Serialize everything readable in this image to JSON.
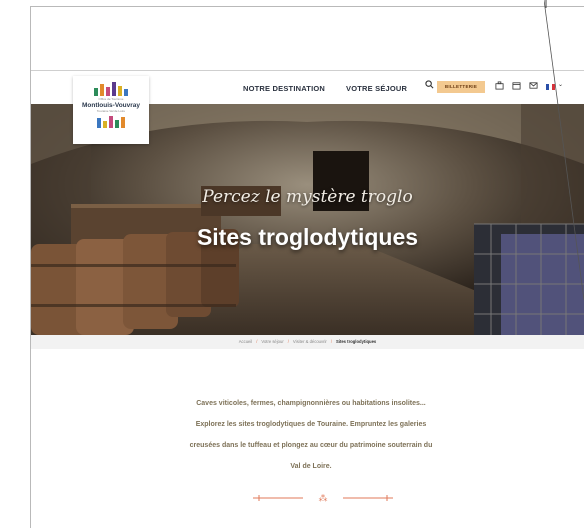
{
  "header": {
    "nav": [
      "NOTRE DESTINATION",
      "VOTRE SÉJOUR"
    ],
    "ticket_label": "BILLETTERIE",
    "icons": [
      "search-icon",
      "pro-icon",
      "calendar-icon",
      "mail-icon",
      "flag-fr-icon"
    ]
  },
  "logo": {
    "tag_top": "Office de Tourisme",
    "name": "Montlouis-Vouvray",
    "tag_bot": "Touraine Val de Loire"
  },
  "hero": {
    "script": "Percez le mystère troglo",
    "title": "Sites troglodytiques"
  },
  "breadcrumb": [
    "Accueil",
    "Votre séjour",
    "Visiter & découvrir",
    "Sites troglodytiques"
  ],
  "intro": {
    "line1": "Caves viticoles, fermes, champignonnières ou habitations insolites...",
    "line2": "Explorez les sites troglodytiques de Touraine. Empruntez les galeries",
    "line3": "creusées dans le tuffeau et plongez au cœur du patrimoine souterrain du",
    "line4": "Val de Loire."
  },
  "colors": {
    "accent": "#e07a5a",
    "ticket_bg": "#f3c990",
    "text": "#2c3340",
    "intro_text": "#7e7258"
  }
}
